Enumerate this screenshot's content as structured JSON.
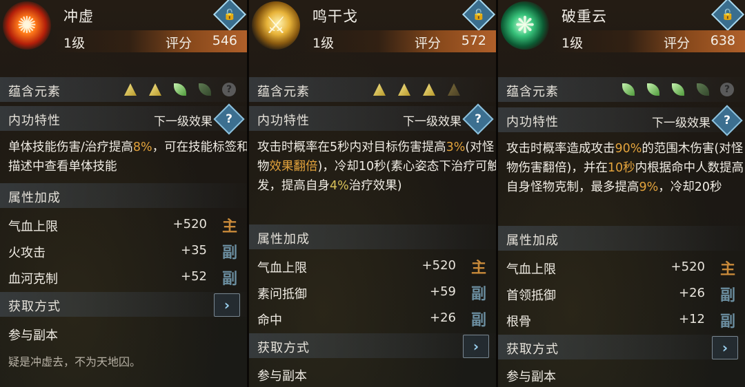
{
  "panels": [
    {
      "name": "冲虚",
      "level": "1级",
      "score_label": "评分",
      "score": "546",
      "elements_label": "蕴含元素",
      "elements": [
        "yellow",
        "yellow",
        "green",
        "green-dim",
        "help"
      ],
      "trait_label": "内功特性",
      "next_label": "下一级效果",
      "desc_parts": [
        "单体技能伤害/治疗提高",
        "8%",
        "，可在技能标签和描述中查看单体技能"
      ],
      "attr_label": "属性加成",
      "attrs": [
        {
          "name": "气血上限",
          "value": "+520",
          "tag": "主"
        },
        {
          "name": "火攻击",
          "value": "+35",
          "tag": "副"
        },
        {
          "name": "血河克制",
          "value": "+52",
          "tag": "副"
        }
      ],
      "acquire_label": "获取方式",
      "acquire_value": "参与副本",
      "quote": "疑是冲虚去，不为天地囚。"
    },
    {
      "name": "鸣干戈",
      "level": "1级",
      "score_label": "评分",
      "score": "572",
      "elements_label": "蕴含元素",
      "elements": [
        "yellow",
        "yellow",
        "yellow",
        "yellow-dim"
      ],
      "trait_label": "内功特性",
      "next_label": "下一级效果",
      "desc_parts": [
        "攻击时概率在5秒内对目标伤害提高",
        "3%",
        "(对怪物",
        "效果翻倍",
        ")，冷却10秒(素心姿态下治疗可触发，提高自身",
        "4%",
        "治疗效果)"
      ],
      "attr_label": "属性加成",
      "attrs": [
        {
          "name": "气血上限",
          "value": "+520",
          "tag": "主"
        },
        {
          "name": "素问抵御",
          "value": "+59",
          "tag": "副"
        },
        {
          "name": "命中",
          "value": "+26",
          "tag": "副"
        }
      ],
      "acquire_label": "获取方式",
      "acquire_value": "参与副本"
    },
    {
      "name": "破重云",
      "level": "1级",
      "score_label": "评分",
      "score": "638",
      "elements_label": "蕴含元素",
      "elements": [
        "green",
        "green",
        "green",
        "green-dim",
        "help"
      ],
      "trait_label": "内功特性",
      "next_label": "下一级效果",
      "desc_parts": [
        "攻击时概率造成攻击",
        "90%",
        "的范围木伤害(对怪物伤害翻倍)，并在",
        "10秒",
        "内根据命中人数提高自身怪物克制，最多提高",
        "9%",
        "，冷却20秒"
      ],
      "attr_label": "属性加成",
      "attrs": [
        {
          "name": "气血上限",
          "value": "+520",
          "tag": "主"
        },
        {
          "name": "首领抵御",
          "value": "+26",
          "tag": "副"
        },
        {
          "name": "根骨",
          "value": "+12",
          "tag": "副"
        }
      ],
      "acquire_label": "获取方式",
      "acquire_value": "参与副本"
    }
  ],
  "colors": {
    "highlight_orange": "#e3a33c",
    "highlight_yellow": "#d9c15a",
    "tag_main": "#c98a3a",
    "tag_sub": "#6b8ea0",
    "score_bar": "#b0602a"
  },
  "icons": {
    "lock": "lock-icon",
    "help": "help-diamond-icon",
    "acquire": "arrow-right-icon"
  }
}
